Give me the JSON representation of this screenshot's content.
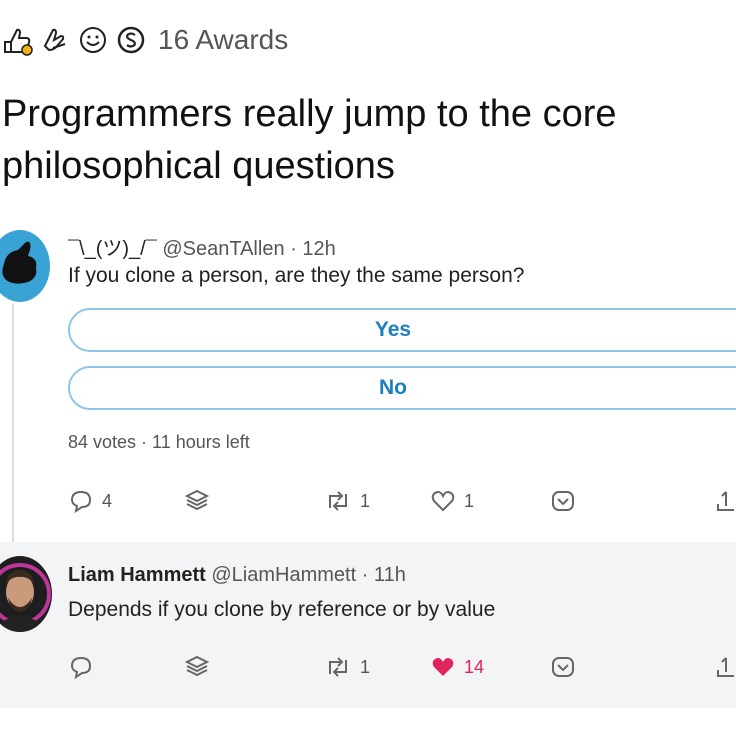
{
  "awards": {
    "icons": [
      "thumbs-up-award-icon",
      "hands-award-icon",
      "grinning-face-award-icon",
      "silver-coin-award-icon"
    ],
    "count_label": "16 Awards"
  },
  "post": {
    "title": "Programmers really jump to the core philosophical questions",
    "title_line1": "Programmers really jump to the core",
    "title_line2": "philosophical questions"
  },
  "tweet1": {
    "display_name": "¯\\_(ツ)_/¯",
    "handle": "@SeanTAllen",
    "time": "· 12h",
    "text": "If you clone a person, are they the same person?",
    "poll": {
      "options": [
        "Yes",
        "No"
      ],
      "meta": "84 votes · 11 hours left"
    },
    "actions": {
      "replies": "4",
      "retweets": "1",
      "likes": "1"
    }
  },
  "tweet2": {
    "display_name": "Liam Hammett",
    "handle": "@LiamHammett",
    "time": "· 11h",
    "text": "Depends if you clone by reference or by value",
    "actions": {
      "retweets": "1",
      "likes": "14"
    }
  },
  "colors": {
    "poll_border": "#8ec6e6",
    "poll_text": "#1b7fc0",
    "liked_heart": "#e0245e",
    "avatar1_bg": "#3aa3d6",
    "reply_bg": "#f2f4f6"
  }
}
